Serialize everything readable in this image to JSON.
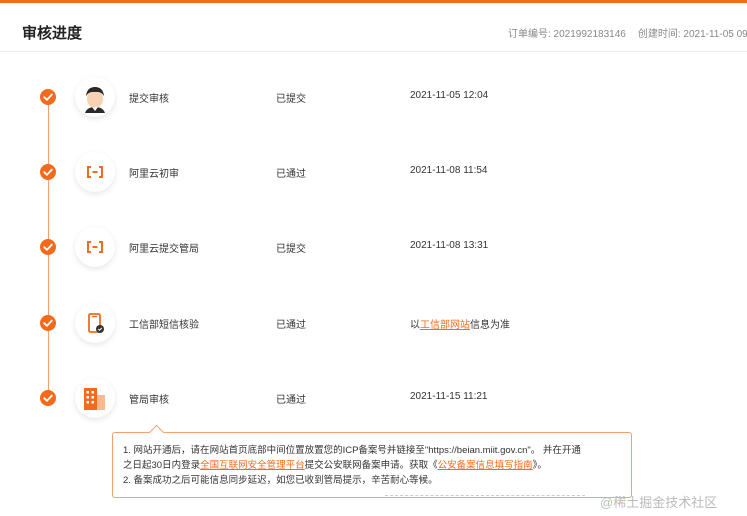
{
  "header": {
    "title": "审核进度",
    "order_label": "订单编号: 2021992183146",
    "created_label": "创建时间: 2021-11-05 09"
  },
  "steps": [
    {
      "icon": "user-avatar-icon",
      "name": "提交审核",
      "status": "已提交",
      "time": "2021-11-05 12:04"
    },
    {
      "icon": "aliyun-logo-icon",
      "name": "阿里云初审",
      "status": "已通过",
      "time": "2021-11-08 11:54"
    },
    {
      "icon": "aliyun-logo-icon",
      "name": "阿里云提交管局",
      "status": "已提交",
      "time": "2021-11-08 13:31"
    },
    {
      "icon": "phone-check-icon",
      "name": "工信部短信核验",
      "status": "已通过",
      "time_prefix": "以",
      "time_link": "工信部网站",
      "time_suffix": "信息为准"
    },
    {
      "icon": "building-icon",
      "name": "管局审核",
      "status": "已通过",
      "time": "2021-11-15 11:21"
    }
  ],
  "notice": {
    "line1": "1. 网站开通后，请在网站首页底部中间位置放置您的ICP备案号并链接至\"https://beian.miit.gov.cn\"。 并在开通",
    "line2_prefix": "之日起30日内登录",
    "line2_link1": "全国互联网安全管理平台",
    "line2_mid": "提交公安联网备案申请。获取《",
    "line2_link2": "公安备案信息填写指南",
    "line2_suffix": "》。",
    "line3": "2. 备案成功之后可能信息同步延迟，如您已收到管局提示，辛苦耐心等候。"
  },
  "watermark": "@稀土掘金技术社区",
  "colors": {
    "accent": "#f26b1d",
    "line": "#f3a170"
  }
}
